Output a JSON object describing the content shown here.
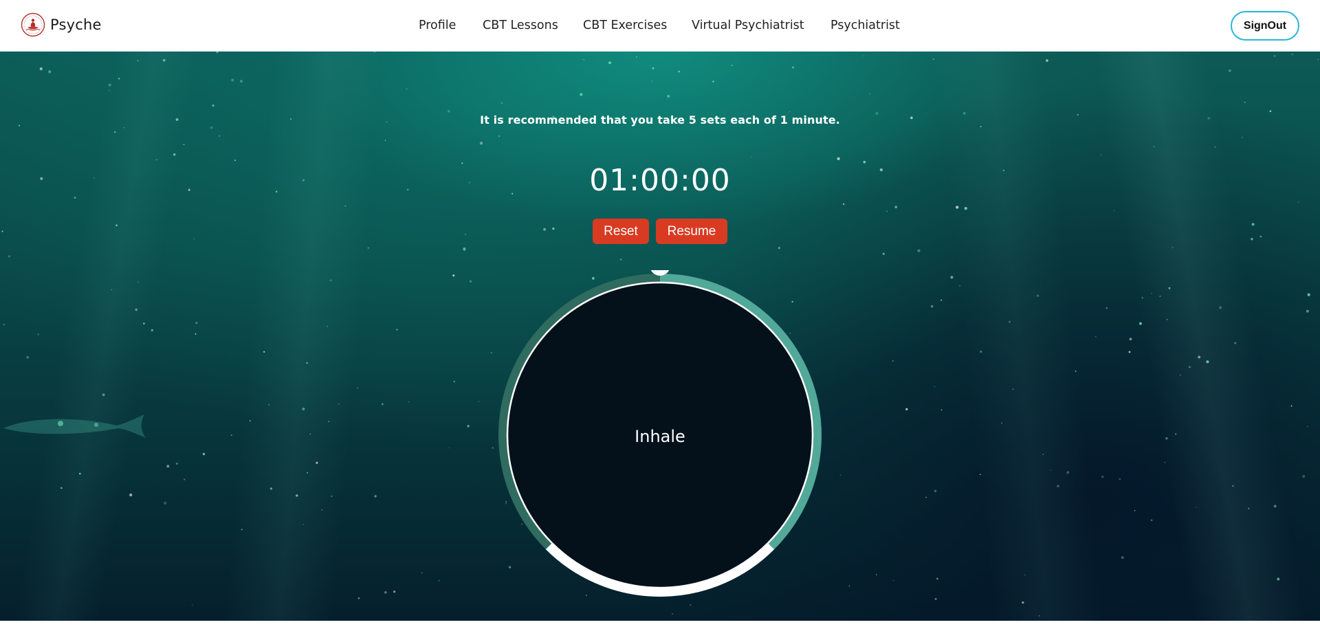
{
  "app": {
    "name": "Psyche",
    "logo_icon": "lotus-meditation-logo-icon"
  },
  "nav": {
    "links": [
      {
        "label": "Profile"
      },
      {
        "label": "CBT Lessons"
      },
      {
        "label": "CBT Exercises"
      },
      {
        "label": "Virtual Psychiatrist"
      },
      {
        "label": "Psychiatrist"
      }
    ],
    "signout_label": "SignOut"
  },
  "exercise": {
    "recommendation": "It is recommended that you take 5 sets each of 1 minute.",
    "timer": "01:00:00",
    "reset_label": "Reset",
    "resume_label": "Resume",
    "phase": "Inhale",
    "progress_fraction": 0.375
  },
  "colors": {
    "accent_button": "#d83b22",
    "signout_border": "#29b6d6",
    "ring_progress": "#52a899",
    "ring_track": "#2f6b5e",
    "ring_complete": "#ffffff",
    "circle_fill": "#04111b"
  }
}
